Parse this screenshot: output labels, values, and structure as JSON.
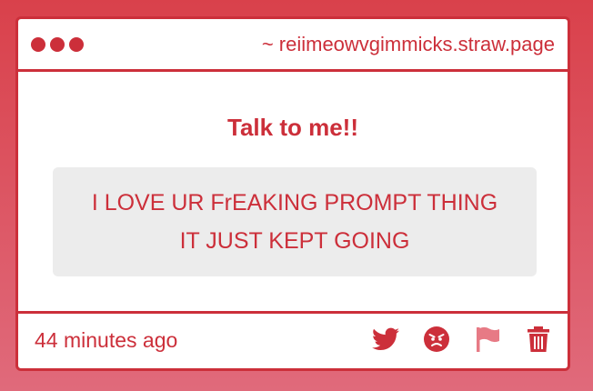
{
  "window": {
    "url": "~ reiimeowvgimmicks.straw.page"
  },
  "main": {
    "title": "Talk to me!!",
    "message_line1": "I LOVE UR FrEAKING PROMPT THING",
    "message_line2": "IT JUST KEPT GOING"
  },
  "footer": {
    "timestamp": "44 minutes ago",
    "actions": [
      {
        "icon": "twitter-icon"
      },
      {
        "icon": "angry-face-icon"
      },
      {
        "icon": "flag-icon"
      },
      {
        "icon": "trash-icon"
      }
    ]
  },
  "colors": {
    "accent": "#cc2f3a",
    "flag": "#e77a85",
    "message_bg": "#ececec"
  }
}
